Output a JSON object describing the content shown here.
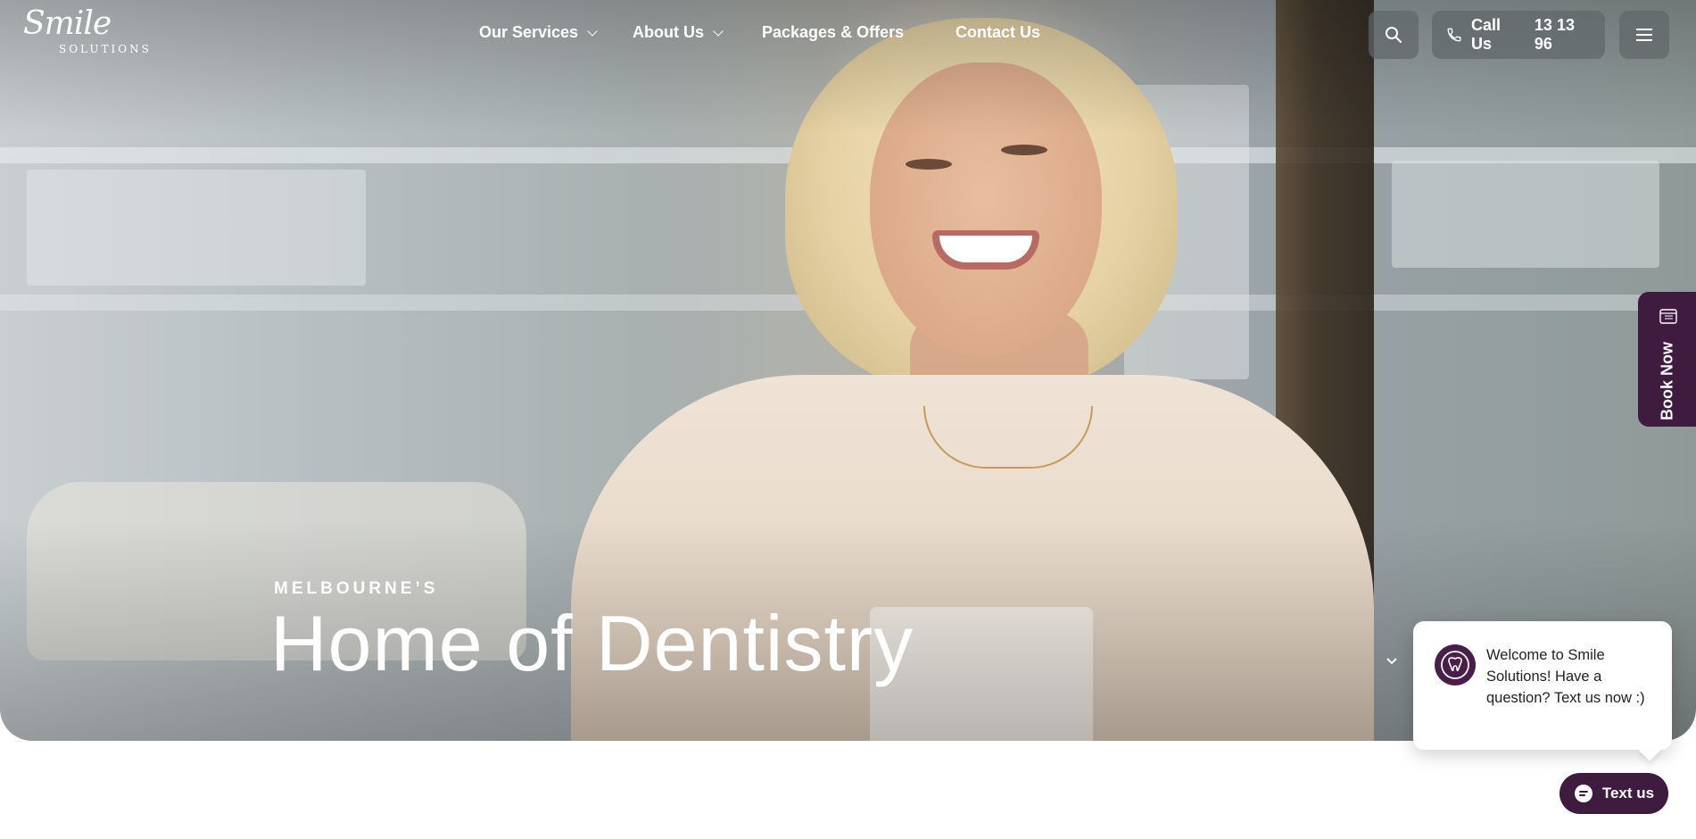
{
  "brand": {
    "script": "Smile",
    "caps": "SOLUTIONS"
  },
  "nav": {
    "items": [
      {
        "label": "Our Services",
        "has_dropdown": true
      },
      {
        "label": "About Us",
        "has_dropdown": true
      },
      {
        "label": "Packages & Offers",
        "has_dropdown": false
      },
      {
        "label": "Contact Us",
        "has_dropdown": false
      }
    ]
  },
  "header": {
    "search_icon": "search-icon",
    "call_label": "Call Us",
    "call_number": "13 13 96",
    "menu_icon": "hamburger-icon"
  },
  "hero": {
    "eyebrow": "MELBOURNE’S",
    "headline": "Home of Dentistry"
  },
  "book_tab": {
    "label": "Book Now"
  },
  "chat": {
    "message": "Welcome to Smile Solutions! Have a question? Text us now :)",
    "button_label": "Text us"
  },
  "colors": {
    "brand_purple": "#3e1b3f",
    "header_button_bg": "#5f676a"
  }
}
